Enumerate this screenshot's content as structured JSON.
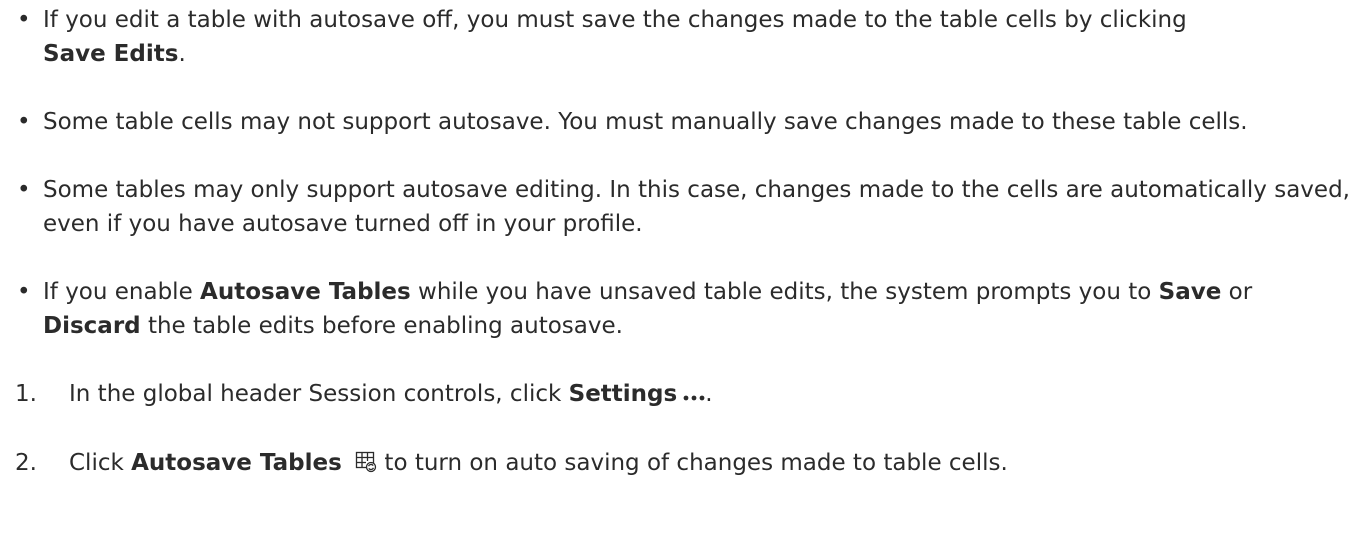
{
  "bullets": [
    {
      "pre": "If you edit a table with autosave off, you must save the changes made to the table cells by clicking",
      "bold": "Save Edits",
      "post": "."
    },
    {
      "text": "Some table cells may not support autosave. You must manually save changes made to these table cells."
    },
    {
      "text": "Some tables may only support autosave editing. In this case, changes made to the cells are automatically saved, even if you have autosave turned off in your profile."
    },
    {
      "pre": "If you enable",
      "bold1": "Autosave Tables",
      "mid": "while you have unsaved table edits, the system prompts you to",
      "bold2": "Save",
      "mid2": "or",
      "bold3": "Discard",
      "post": "the table edits before enabling autosave."
    }
  ],
  "steps": [
    {
      "number": "1.",
      "pre": "In the global header Session controls, click",
      "bold": "Settings",
      "icon": "more-dots-icon",
      "post": "."
    },
    {
      "number": "2.",
      "pre": "Click",
      "bold": "Autosave Tables",
      "icon": "autosave-table-icon",
      "post": "to turn on auto saving of changes made to table cells."
    }
  ]
}
